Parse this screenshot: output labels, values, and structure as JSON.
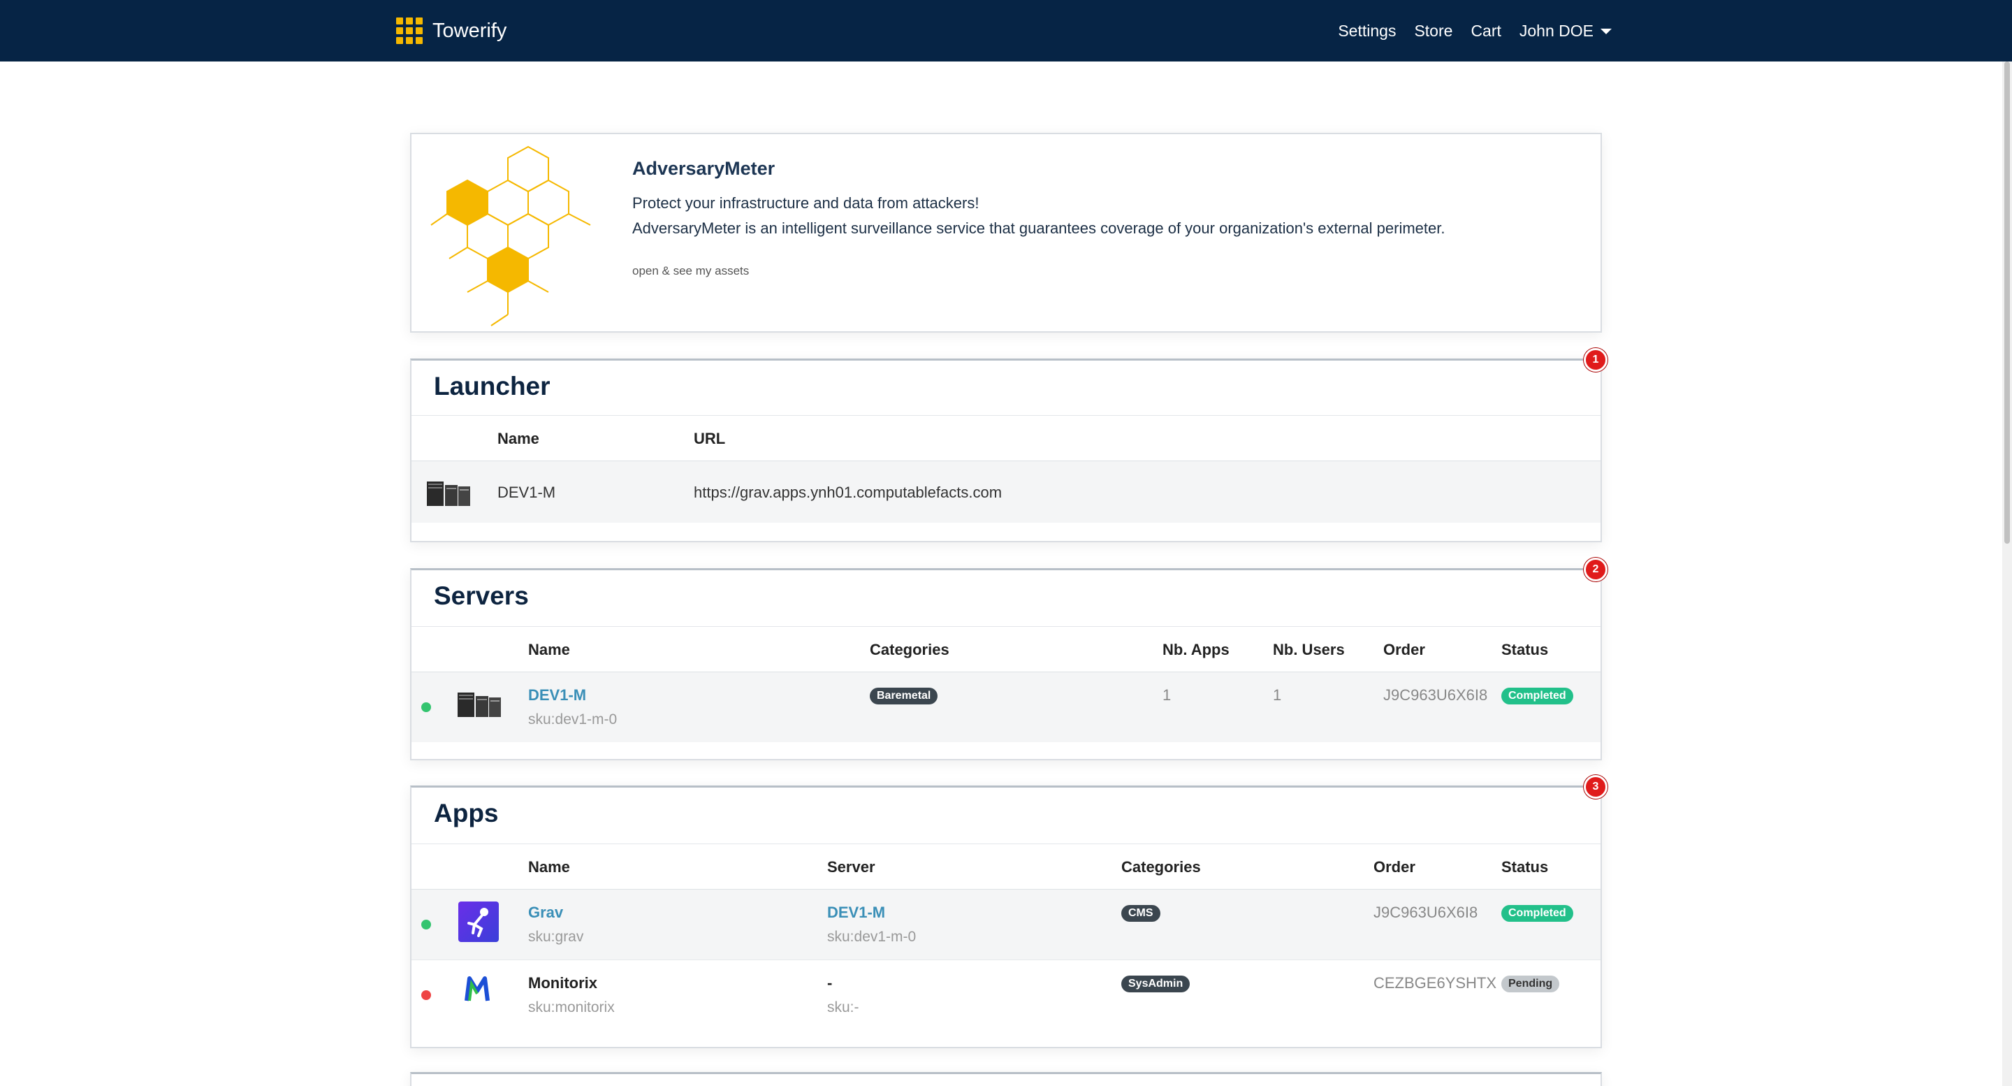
{
  "navbar": {
    "brand": "Towerify",
    "links": [
      "Settings",
      "Store",
      "Cart"
    ],
    "user": "John DOE"
  },
  "promo": {
    "title": "AdversaryMeter",
    "line1": "Protect your infrastructure and data from attackers!",
    "line2": "AdversaryMeter is an intelligent surveillance service that guarantees coverage of your organization's external perimeter.",
    "link": "open & see my assets",
    "accent_color": "#f5b800"
  },
  "launcher": {
    "title": "Launcher",
    "badge": "1",
    "columns": [
      "Name",
      "URL"
    ],
    "rows": [
      {
        "icon": "server-rack-icon",
        "name": "DEV1-M",
        "url": "https://grav.apps.ynh01.computablefacts.com"
      }
    ]
  },
  "servers": {
    "title": "Servers",
    "badge": "2",
    "columns": [
      "Name",
      "Categories",
      "Nb. Apps",
      "Nb. Users",
      "Order",
      "Status"
    ],
    "rows": [
      {
        "status_dot": "green",
        "icon": "server-rack-icon",
        "name": "DEV1-M",
        "sku": "sku:dev1-m-0",
        "category": "Baremetal",
        "nb_apps": "1",
        "nb_users": "1",
        "order": "J9C963U6X6I8",
        "status": "Completed"
      }
    ]
  },
  "apps": {
    "title": "Apps",
    "badge": "3",
    "columns": [
      "Name",
      "Server",
      "Categories",
      "Order",
      "Status"
    ],
    "rows": [
      {
        "status_dot": "green",
        "icon": "grav-logo-icon",
        "name": "Grav",
        "sku": "sku:grav",
        "server": "DEV1-M",
        "server_sku": "sku:dev1-m-0",
        "category": "CMS",
        "order": "J9C963U6X6I8",
        "status": "Completed"
      },
      {
        "status_dot": "red",
        "icon": "monitorix-logo-icon",
        "name": "Monitorix",
        "sku": "sku:monitorix",
        "server": "-",
        "server_sku": "sku:-",
        "category": "SysAdmin",
        "order": "CEZBGE6YSHTX",
        "status": "Pending"
      }
    ]
  }
}
